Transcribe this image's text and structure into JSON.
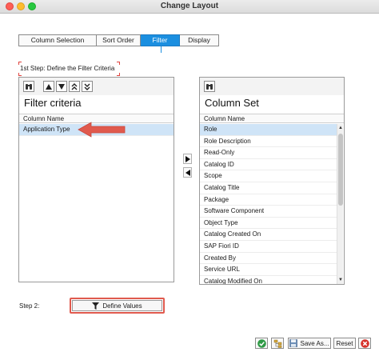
{
  "window": {
    "title": "Change Layout"
  },
  "tabs": [
    {
      "label": "Column Selection",
      "active": false
    },
    {
      "label": "Sort Order",
      "active": false
    },
    {
      "label": "Filter",
      "active": true
    },
    {
      "label": "Display",
      "active": false
    }
  ],
  "step1_label": "1st Step: Define the Filter Criteria",
  "filter_panel": {
    "title": "Filter criteria",
    "column_header": "Column Name",
    "rows": [
      "Application Type"
    ],
    "selected_index": 0
  },
  "column_set_panel": {
    "title": "Column Set",
    "column_header": "Column Name",
    "rows": [
      "Role",
      "Role Description",
      "Read-Only",
      "Catalog ID",
      "Scope",
      "Catalog Title",
      "Package",
      "Software Component",
      "Object Type",
      "Catalog Created On",
      "SAP Fiori ID",
      "Created By",
      "Service URL",
      "Catalog Modified On"
    ],
    "selected_index": 0
  },
  "step2_label": "Step 2:",
  "define_values_label": "Define Values",
  "footer": {
    "save_as_label": "Save As...",
    "reset_label": "Reset"
  },
  "colors": {
    "accent": "#1b8fe0",
    "selection": "#cfe4f7",
    "highlight": "#e05a4e"
  },
  "icons": {
    "find": "binoculars-icon",
    "move_up": "triangle-up-icon",
    "move_down": "triangle-down-icon",
    "move_top": "double-chevron-up-icon",
    "move_bottom": "double-chevron-down-icon",
    "add": "triangle-right-icon",
    "remove": "triangle-left-icon",
    "filter": "funnel-icon",
    "confirm": "checkmark-icon",
    "layout": "layout-tree-icon",
    "cancel": "cancel-icon"
  }
}
